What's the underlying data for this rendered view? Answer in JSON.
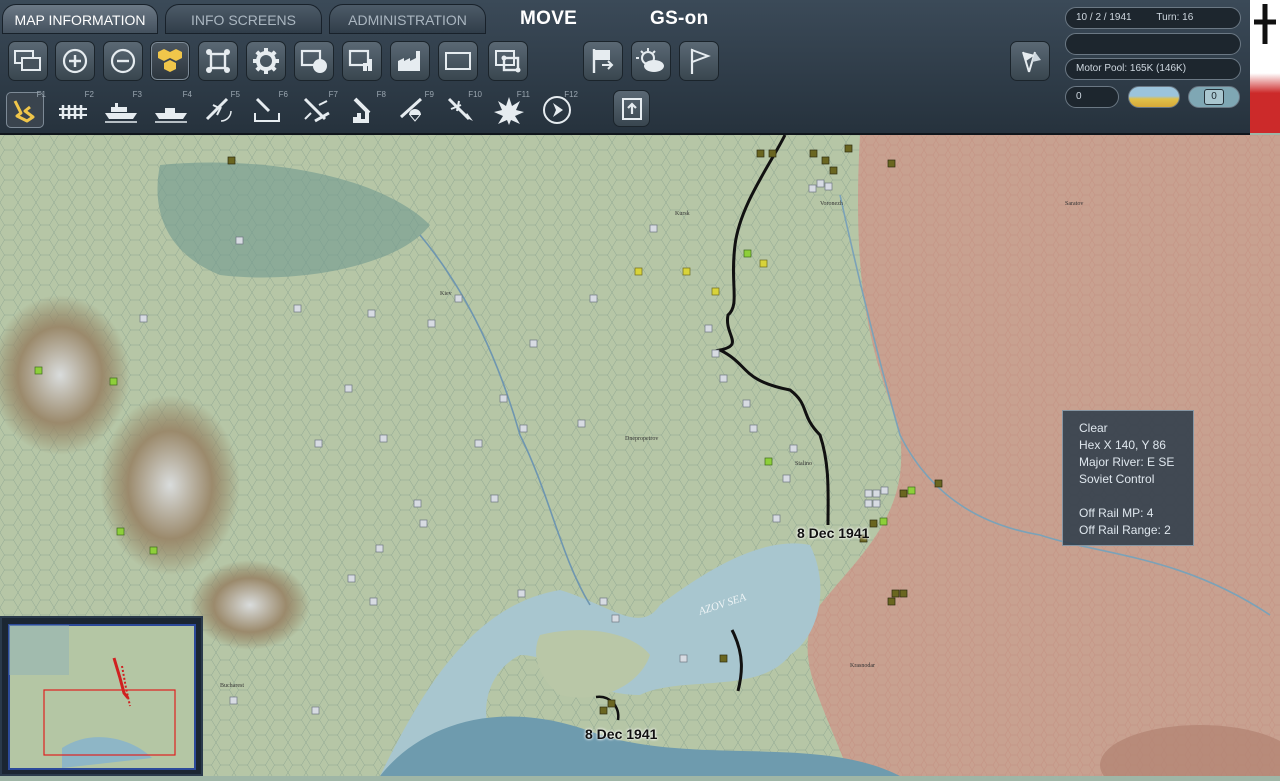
{
  "tabs": [
    {
      "label": "MAP INFORMATION",
      "active": true
    },
    {
      "label": "INFO SCREENS",
      "active": false
    },
    {
      "label": "ADMINISTRATION",
      "active": false
    }
  ],
  "mode_label": "MOVE",
  "gs_label": "GS-on",
  "toolbar_row1": [
    {
      "icon": "windows-icon"
    },
    {
      "icon": "zoom-in-icon"
    },
    {
      "icon": "zoom-out-icon"
    },
    {
      "icon": "hex-units-icon",
      "selected": true
    },
    {
      "icon": "frame-icon"
    },
    {
      "icon": "gear-icon"
    },
    {
      "icon": "unit-counter-icon"
    },
    {
      "icon": "supply-icon"
    },
    {
      "icon": "factory-icon"
    },
    {
      "icon": "rectangle-icon"
    },
    {
      "icon": "multi-frame-icon"
    },
    {
      "icon": "flag-arrow-icon"
    },
    {
      "icon": "weather-icon"
    },
    {
      "icon": "flag-outline-icon"
    },
    {
      "icon": "axes-flags-icon"
    }
  ],
  "toolbar_row2": [
    {
      "icon": "ground-move-icon",
      "key": "F1",
      "selected": true
    },
    {
      "icon": "rail-move-icon",
      "key": "F2"
    },
    {
      "icon": "naval-transport-icon",
      "key": "F3"
    },
    {
      "icon": "naval-move-icon",
      "key": "F4"
    },
    {
      "icon": "air-recon-icon",
      "key": "F5"
    },
    {
      "icon": "supply-drop-icon",
      "key": "F6"
    },
    {
      "icon": "air-transport-icon",
      "key": "F7"
    },
    {
      "icon": "city-bomb-icon",
      "key": "F8"
    },
    {
      "icon": "paradrop-icon",
      "key": "F9"
    },
    {
      "icon": "air-attack-icon",
      "key": "F10"
    },
    {
      "icon": "explosion-icon",
      "key": "F11"
    },
    {
      "icon": "next-icon",
      "key": "F12"
    },
    {
      "icon": "upload-icon"
    }
  ],
  "status": {
    "date": "10 / 2 / 1941",
    "turn": "Turn: 16",
    "empty_field": "",
    "motor_pool": "Motor Pool:  165K (146K)",
    "value_left": "0",
    "value_right": "0"
  },
  "tooltip": {
    "terrain": "Clear",
    "hex": "Hex X 140, Y 86",
    "river": "Major River: E SE",
    "control": "Soviet Control",
    "off_rail_mp": "Off Rail MP: 4",
    "off_rail_range": "Off Rail Range: 2"
  },
  "map_labels": {
    "date_label_1": "8 Dec 1941",
    "date_label_2": "8 Dec 1941",
    "sea": "AZOV SEA",
    "kiev": "Kiev",
    "dnepro": "Dnepropetrov",
    "kursk": "Kursk",
    "voronezh": "Voronezh",
    "saratov": "Saratov",
    "stalino": "Stalino",
    "krasnodar": "Krasnodar",
    "bucharest": "Bucharest"
  }
}
